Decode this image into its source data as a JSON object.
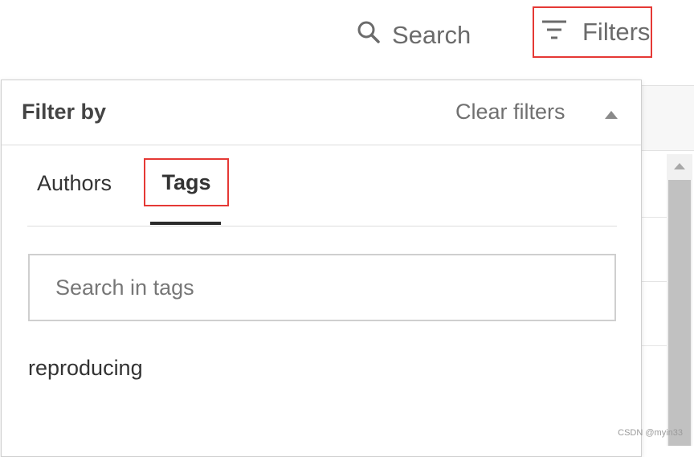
{
  "toolbar": {
    "search_label": "Search",
    "search_icon": "search-icon",
    "filters_label": "Filters",
    "filters_icon": "filter-lines-icon"
  },
  "filter_panel": {
    "title": "Filter by",
    "clear_label": "Clear filters",
    "collapse_icon": "caret-up-icon",
    "tabs": [
      {
        "label": "Authors",
        "active": false
      },
      {
        "label": "Tags",
        "active": true
      }
    ],
    "search": {
      "placeholder": "Search in tags",
      "value": ""
    },
    "tags": [
      "reproducing"
    ]
  },
  "watermark": "CSDN @myin33",
  "colors": {
    "highlight_border": "#e53935",
    "active_tab_underline": "#2b2b2b"
  }
}
